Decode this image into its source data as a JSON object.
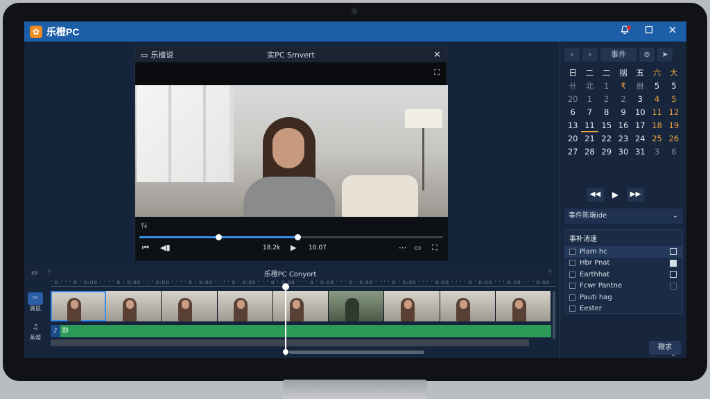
{
  "app": {
    "logo_glyph": "✿",
    "title": "乐橙PC"
  },
  "titlebar": {
    "bell_icon": "bell-icon",
    "maximize_icon": "maximize-icon",
    "close_icon": "close-icon"
  },
  "player": {
    "left_label": "乐檀说",
    "title": "实PC Smvert",
    "close": "✕",
    "fullscreen_icon": "⛶",
    "adjust_icon": "⫯⫰",
    "time_current": "18.2k",
    "time_total": "10.07",
    "progress_played": 0.26,
    "progress_buffered": 0.52,
    "buttons": {
      "prev": "⏮",
      "step_back": "◀▮",
      "play": "▶",
      "more": "⋯",
      "caption": "▭",
      "expand": "⛶"
    }
  },
  "calendar": {
    "nav_prev": "‹",
    "nav_next": "›",
    "label": "事件",
    "view_icon": "⊜",
    "forward": "➤",
    "weekdays": [
      "日",
      "二",
      "二",
      "揣",
      "五",
      "六",
      "大"
    ],
    "rows": [
      [
        "卄",
        "北",
        "1",
        "₹",
        "卌",
        "5",
        "5"
      ],
      [
        "20",
        "1",
        "2",
        "2",
        "3",
        "4",
        "5"
      ],
      [
        "6",
        "7",
        "8",
        "9",
        "10",
        "11",
        "12"
      ],
      [
        "13",
        "11",
        "15",
        "16",
        "17",
        "18",
        "19"
      ],
      [
        "20",
        "21",
        "22",
        "23",
        "24",
        "25",
        "26"
      ],
      [
        "27",
        "28",
        "29",
        "30",
        "31",
        "3",
        "6"
      ]
    ],
    "media": {
      "rewind": "◀◀",
      "play": "▶",
      "forward": "▶▶"
    }
  },
  "dropdown": {
    "label": "事件陈端ide",
    "chevron": "⌄"
  },
  "events": {
    "title": "事补消速",
    "items": [
      {
        "label": "Plam hc",
        "checked": false,
        "selected": true
      },
      {
        "label": "Hbr Pnat",
        "checked": true,
        "selected": false
      },
      {
        "label": "Earthhat",
        "checked": false,
        "selected": false
      },
      {
        "label": "Fcwr Pantne",
        "checked": false,
        "selected": false
      },
      {
        "label": "Pauti hag",
        "checked": false,
        "selected": false
      },
      {
        "label": "Eester",
        "checked": false,
        "selected": false
      }
    ]
  },
  "search_button": "鞭求",
  "corner_mark": "↘",
  "timeline": {
    "left_icon": "▭",
    "grid_icon": "⫶⫶",
    "title": "乐橙PC Conyort",
    "right_icon": "⫶⫶",
    "ruler": "' 0 ' ' ' 0 ' 0:00 ' ' ' ' 0 ' 0:00 ' ' ' 0:00 ' ' ' ' 0 ' 0:00 ' ' ' ' 0 ' 0:00 ' ' ' 0 ' 0:00 ' ' ' 0 ' 0:00 ' ' ' 0 ' 0:00 ' ' ' ' 0 ' 0:00 ' ' ' ' 0:00 ' ' ' ' 0 ' 0:00 ' ' ' 0:00 ' ' ' 0:00",
    "tool_cut_icon": "✂",
    "tool_cut_label": "翼鼠",
    "tool_bell_icon": "♫",
    "tool_bell_label": "蒸嬛",
    "audio_icon": "♪",
    "audio_label": "即"
  }
}
